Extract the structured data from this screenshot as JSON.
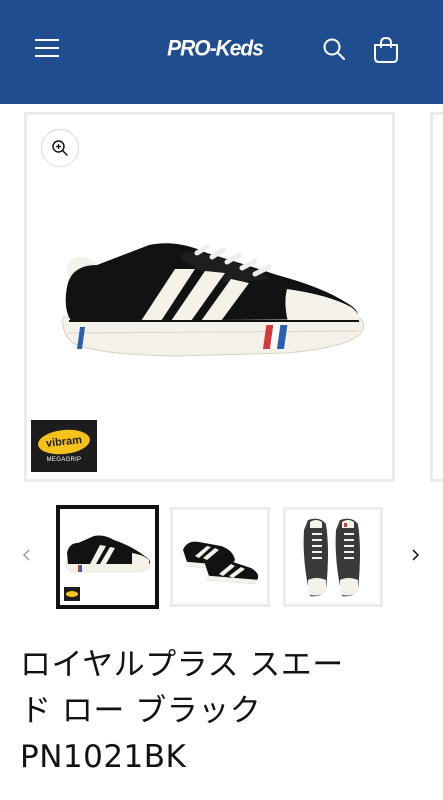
{
  "header": {
    "brand_logo_text": "PRO-Keds",
    "background_color": "#1f4d8d",
    "menu_icon": "hamburger-icon",
    "search_icon": "search-icon",
    "cart_icon": "cart-bag-icon"
  },
  "gallery": {
    "main_image_alt": "black suede sneaker with white stripes",
    "badge": {
      "logo_text": "vibram",
      "sub_text": "MEGAGRIP",
      "color": "#f4c21a"
    },
    "zoom_icon": "zoom-in-icon",
    "thumbnails": [
      {
        "alt": "side view",
        "active": true
      },
      {
        "alt": "pair view",
        "active": false
      },
      {
        "alt": "top view",
        "active": false
      }
    ],
    "prev_icon": "chevron-left-icon",
    "next_icon": "chevron-right-icon"
  },
  "product": {
    "title_line1": "ロイヤルプラス スエー",
    "title_line2": "ド ロー ブラック",
    "title_line3": "PN1021BK"
  }
}
